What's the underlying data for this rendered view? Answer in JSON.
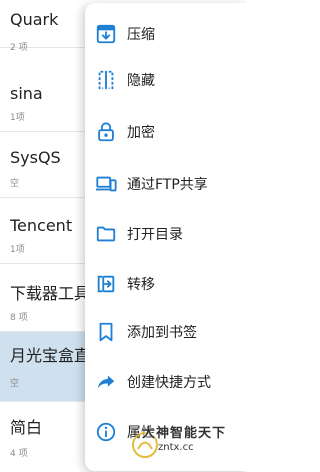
{
  "folders": [
    {
      "name": "Quark",
      "sub": "2 项",
      "selected": false
    },
    {
      "name": "sina",
      "sub": "1项",
      "selected": false
    },
    {
      "name": "SysQS",
      "sub": "空",
      "selected": false
    },
    {
      "name": "Tencent",
      "sub": "1项",
      "selected": false
    },
    {
      "name": "下载器工具",
      "sub": "8 项",
      "selected": false
    },
    {
      "name": "月光宝盒直",
      "sub": "空",
      "selected": true
    },
    {
      "name": "简白",
      "sub": "4 项",
      "selected": false
    }
  ],
  "menu": {
    "items": [
      {
        "label": "压缩",
        "icon": "compress-icon"
      },
      {
        "label": "隐藏",
        "icon": "hide-icon"
      },
      {
        "label": "加密",
        "icon": "lock-icon"
      },
      {
        "label": "通过FTP共享",
        "icon": "ftp-share-icon"
      },
      {
        "label": "打开目录",
        "icon": "folder-icon"
      },
      {
        "label": "转移",
        "icon": "transfer-icon"
      },
      {
        "label": "添加到书签",
        "icon": "bookmark-icon"
      },
      {
        "label": "创建快捷方式",
        "icon": "shortcut-icon"
      },
      {
        "label": "属性",
        "icon": "info-icon"
      }
    ]
  },
  "watermark": {
    "line1": "大神智能天下",
    "line2": "zntx.cc"
  },
  "colors": {
    "accent": "#1e7fd4",
    "selected_row": "#cfe0ef"
  }
}
